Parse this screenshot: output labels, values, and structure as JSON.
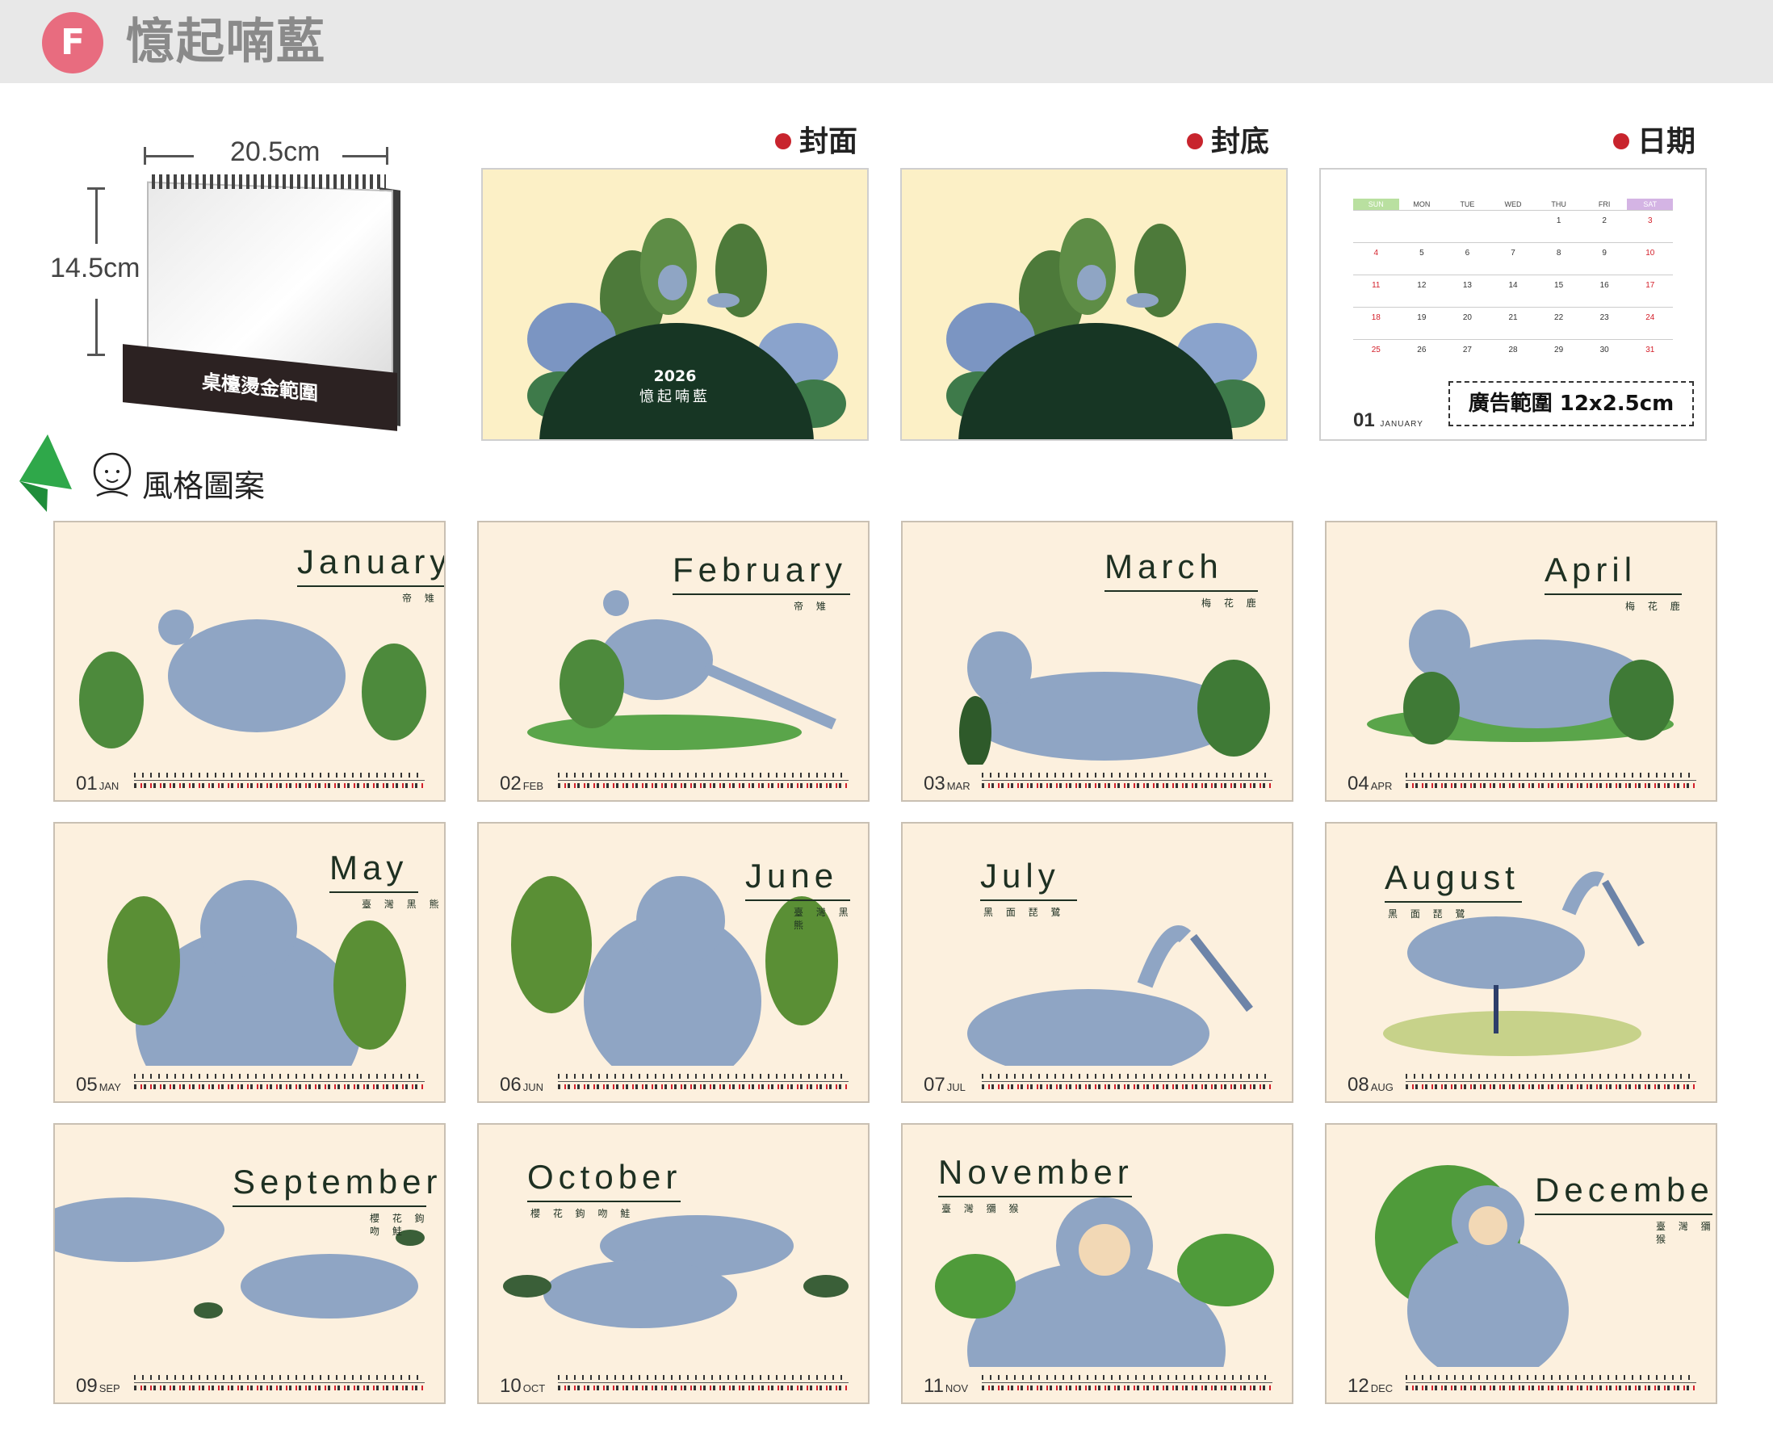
{
  "header": {
    "badge": "F",
    "title": "憶起喃藍"
  },
  "desk_calendar": {
    "width_label": "20.5cm",
    "height_label": "14.5cm",
    "base_text": "桌檯燙金範圍"
  },
  "labels": {
    "cover": "封面",
    "back": "封底",
    "date": "日期",
    "style": "風格圖案"
  },
  "cover": {
    "year": "2026",
    "name": "憶起喃藍"
  },
  "date_page": {
    "weekdays": [
      "SUN",
      "MON",
      "TUE",
      "WED",
      "THU",
      "FRI",
      "SAT"
    ],
    "weeks": [
      [
        "",
        "",
        "",
        "",
        "1",
        "2",
        "3"
      ],
      [
        "4",
        "5",
        "6",
        "7",
        "8",
        "9",
        "10"
      ],
      [
        "11",
        "12",
        "13",
        "14",
        "15",
        "16",
        "17"
      ],
      [
        "18",
        "19",
        "20",
        "21",
        "22",
        "23",
        "24"
      ],
      [
        "25",
        "26",
        "27",
        "28",
        "29",
        "30",
        "31"
      ]
    ],
    "ad_text": "廣告範圍 12x2.5cm",
    "month_num": "01",
    "month_en": "JANUARY"
  },
  "months": [
    {
      "name": "January",
      "sub": "帝 雉",
      "num": "01",
      "abbr": "JAN"
    },
    {
      "name": "February",
      "sub": "帝 雉",
      "num": "02",
      "abbr": "FEB"
    },
    {
      "name": "March",
      "sub": "梅 花 鹿",
      "num": "03",
      "abbr": "MAR"
    },
    {
      "name": "April",
      "sub": "梅 花 鹿",
      "num": "04",
      "abbr": "APR"
    },
    {
      "name": "May",
      "sub": "臺 灣 黑 熊",
      "num": "05",
      "abbr": "MAY"
    },
    {
      "name": "June",
      "sub": "臺 灣 黑 熊",
      "num": "06",
      "abbr": "JUN"
    },
    {
      "name": "July",
      "sub": "黑 面 琵 鷺",
      "num": "07",
      "abbr": "JUL"
    },
    {
      "name": "August",
      "sub": "黑 面 琵 鷺",
      "num": "08",
      "abbr": "AUG"
    },
    {
      "name": "September",
      "sub": "櫻 花 鉤 吻 鮭",
      "num": "09",
      "abbr": "SEP"
    },
    {
      "name": "October",
      "sub": "櫻 花 鉤 吻 鮭",
      "num": "10",
      "abbr": "OCT"
    },
    {
      "name": "November",
      "sub": "臺 灣 獼 猴",
      "num": "11",
      "abbr": "NOV"
    },
    {
      "name": "December",
      "sub": "臺 灣 獼 猴",
      "num": "12",
      "abbr": "DEC"
    }
  ],
  "colors": {
    "badge": "#e86c7f",
    "accent_red": "#c8242d",
    "card_bg": "#fcf0de",
    "cover_bg": "#fcf0c6",
    "animal_blue": "#8fa5c4",
    "leaf_green": "#4d8a3c"
  }
}
